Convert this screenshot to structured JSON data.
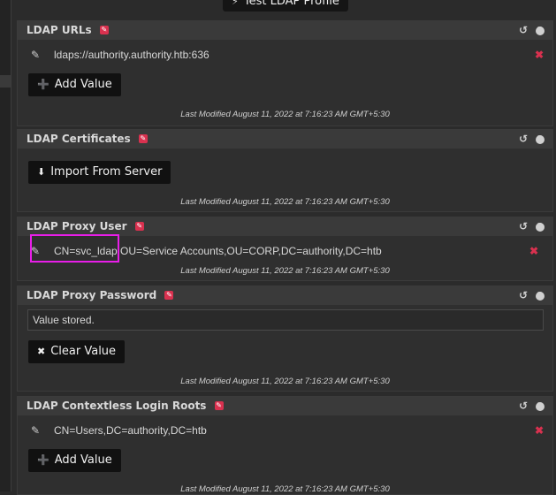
{
  "top_button": {
    "label": "Test LDAP Profile",
    "icon": "bolt-icon"
  },
  "panels": [
    {
      "title": "LDAP URLs",
      "values": [
        "ldaps://authority.authority.htb:636"
      ],
      "button": "Add Value",
      "last_modified": "Last Modified August 11, 2022 at 7:16:23 AM GMT+5:30"
    },
    {
      "title": "LDAP Certificates",
      "button": "Import From Server",
      "last_modified": "Last Modified August 11, 2022 at 7:16:23 AM GMT+5:30"
    },
    {
      "title": "LDAP Proxy User",
      "values": [
        "CN=svc_ldap,OU=Service Accounts,OU=CORP,DC=authority,DC=htb"
      ],
      "last_modified": "Last Modified August 11, 2022 at 7:16:23 AM GMT+5:30"
    },
    {
      "title": "LDAP Proxy Password",
      "stored_text": "Value stored.",
      "button": "Clear Value",
      "last_modified": "Last Modified August 11, 2022 at 7:16:23 AM GMT+5:30"
    },
    {
      "title": "LDAP Contextless Login Roots",
      "values": [
        "CN=Users,DC=authority,DC=htb"
      ],
      "button": "Add Value",
      "last_modified": "Last Modified August 11, 2022 at 7:16:23 AM GMT+5:30"
    }
  ],
  "colors": {
    "accent": "#d9314f",
    "highlight": "#e81ee8",
    "background": "#2b2b2b"
  }
}
